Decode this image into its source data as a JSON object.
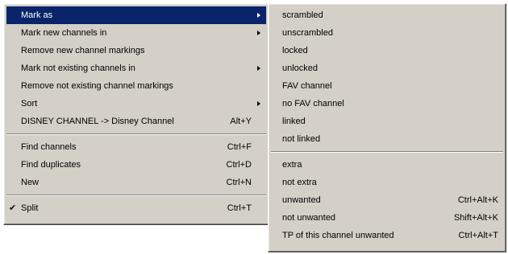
{
  "main_menu": {
    "items": [
      {
        "label": "Mark as",
        "shortcut": "",
        "submenu": true,
        "checked": false,
        "highlighted": true
      },
      {
        "label": "Mark new channels in",
        "shortcut": "",
        "submenu": true,
        "checked": false,
        "highlighted": false
      },
      {
        "label": "Remove new channel markings",
        "shortcut": "",
        "submenu": false,
        "checked": false,
        "highlighted": false
      },
      {
        "label": "Mark not existing channels in",
        "shortcut": "",
        "submenu": true,
        "checked": false,
        "highlighted": false
      },
      {
        "label": "Remove not existing channel markings",
        "shortcut": "",
        "submenu": false,
        "checked": false,
        "highlighted": false
      },
      {
        "label": "Sort",
        "shortcut": "",
        "submenu": true,
        "checked": false,
        "highlighted": false
      },
      {
        "label": "DISNEY CHANNEL -> Disney Channel",
        "shortcut": "Alt+Y",
        "submenu": false,
        "checked": false,
        "highlighted": false
      },
      {
        "label": "Find channels",
        "shortcut": "Ctrl+F",
        "submenu": false,
        "checked": false,
        "highlighted": false
      },
      {
        "label": "Find duplicates",
        "shortcut": "Ctrl+D",
        "submenu": false,
        "checked": false,
        "highlighted": false
      },
      {
        "label": "New",
        "shortcut": "Ctrl+N",
        "submenu": false,
        "checked": false,
        "highlighted": false
      },
      {
        "label": "Split",
        "shortcut": "Ctrl+T",
        "submenu": false,
        "checked": true,
        "highlighted": false
      }
    ],
    "check_glyph": "✔"
  },
  "sub_menu": {
    "items": [
      {
        "label": "scrambled",
        "shortcut": ""
      },
      {
        "label": "unscrambled",
        "shortcut": ""
      },
      {
        "label": "locked",
        "shortcut": ""
      },
      {
        "label": "unlocked",
        "shortcut": ""
      },
      {
        "label": "FAV channel",
        "shortcut": ""
      },
      {
        "label": "no FAV channel",
        "shortcut": ""
      },
      {
        "label": "linked",
        "shortcut": ""
      },
      {
        "label": "not linked",
        "shortcut": ""
      },
      {
        "label": "extra",
        "shortcut": ""
      },
      {
        "label": "not extra",
        "shortcut": ""
      },
      {
        "label": "unwanted",
        "shortcut": "Ctrl+Alt+K"
      },
      {
        "label": "not unwanted",
        "shortcut": "Shift+Alt+K"
      },
      {
        "label": "TP of this channel unwanted",
        "shortcut": "Ctrl+Alt+T"
      }
    ]
  },
  "colors": {
    "menu_background": "#d4d0c8",
    "highlight_background": "#0a246a",
    "highlight_text": "#ffffff"
  }
}
